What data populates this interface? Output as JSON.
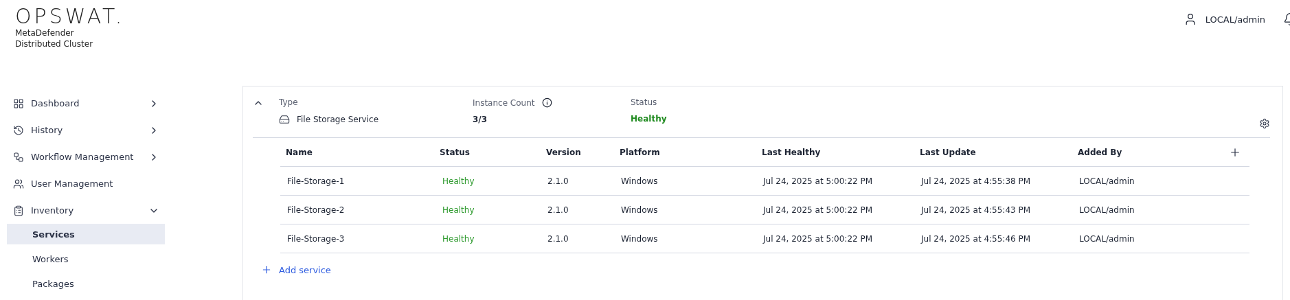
{
  "brand": {
    "logo": "OPSWAT.",
    "product_line_1": "MetaDefender",
    "product_line_2": "Distributed Cluster"
  },
  "user": {
    "name": "LOCAL/admin"
  },
  "sidebar": {
    "items": [
      {
        "label": "Dashboard",
        "expanded": false
      },
      {
        "label": "History",
        "expanded": false
      },
      {
        "label": "Workflow Management",
        "expanded": false
      },
      {
        "label": "User Management"
      },
      {
        "label": "Inventory",
        "expanded": true,
        "children": [
          {
            "label": "Services",
            "selected": true
          },
          {
            "label": "Workers",
            "selected": false
          },
          {
            "label": "Packages",
            "selected": false
          }
        ]
      }
    ]
  },
  "service_group": {
    "expanded": true,
    "type_label": "Type",
    "type_value": "File Storage Service",
    "count_label": "Instance Count",
    "count_value": "3/3",
    "status_label": "Status",
    "status_value": "Healthy",
    "table": {
      "columns": [
        "Name",
        "Status",
        "Version",
        "Platform",
        "Last Healthy",
        "Last Update",
        "Added By"
      ],
      "rows": [
        {
          "name": "File-Storage-1",
          "status": "Healthy",
          "version": "2.1.0",
          "platform": "Windows",
          "last_healthy": "Jul 24, 2025 at 5:00:22 PM",
          "last_update": "Jul 24, 2025 at 4:55:38 PM",
          "added_by": "LOCAL/admin"
        },
        {
          "name": "File-Storage-2",
          "status": "Healthy",
          "version": "2.1.0",
          "platform": "Windows",
          "last_healthy": "Jul 24, 2025 at 5:00:22 PM",
          "last_update": "Jul 24, 2025 at 4:55:43 PM",
          "added_by": "LOCAL/admin"
        },
        {
          "name": "File-Storage-3",
          "status": "Healthy",
          "version": "2.1.0",
          "platform": "Windows",
          "last_healthy": "Jul 24, 2025 at 5:00:22 PM",
          "last_update": "Jul 24, 2025 at 4:55:46 PM",
          "added_by": "LOCAL/admin"
        }
      ]
    },
    "add_button": "Add service"
  }
}
